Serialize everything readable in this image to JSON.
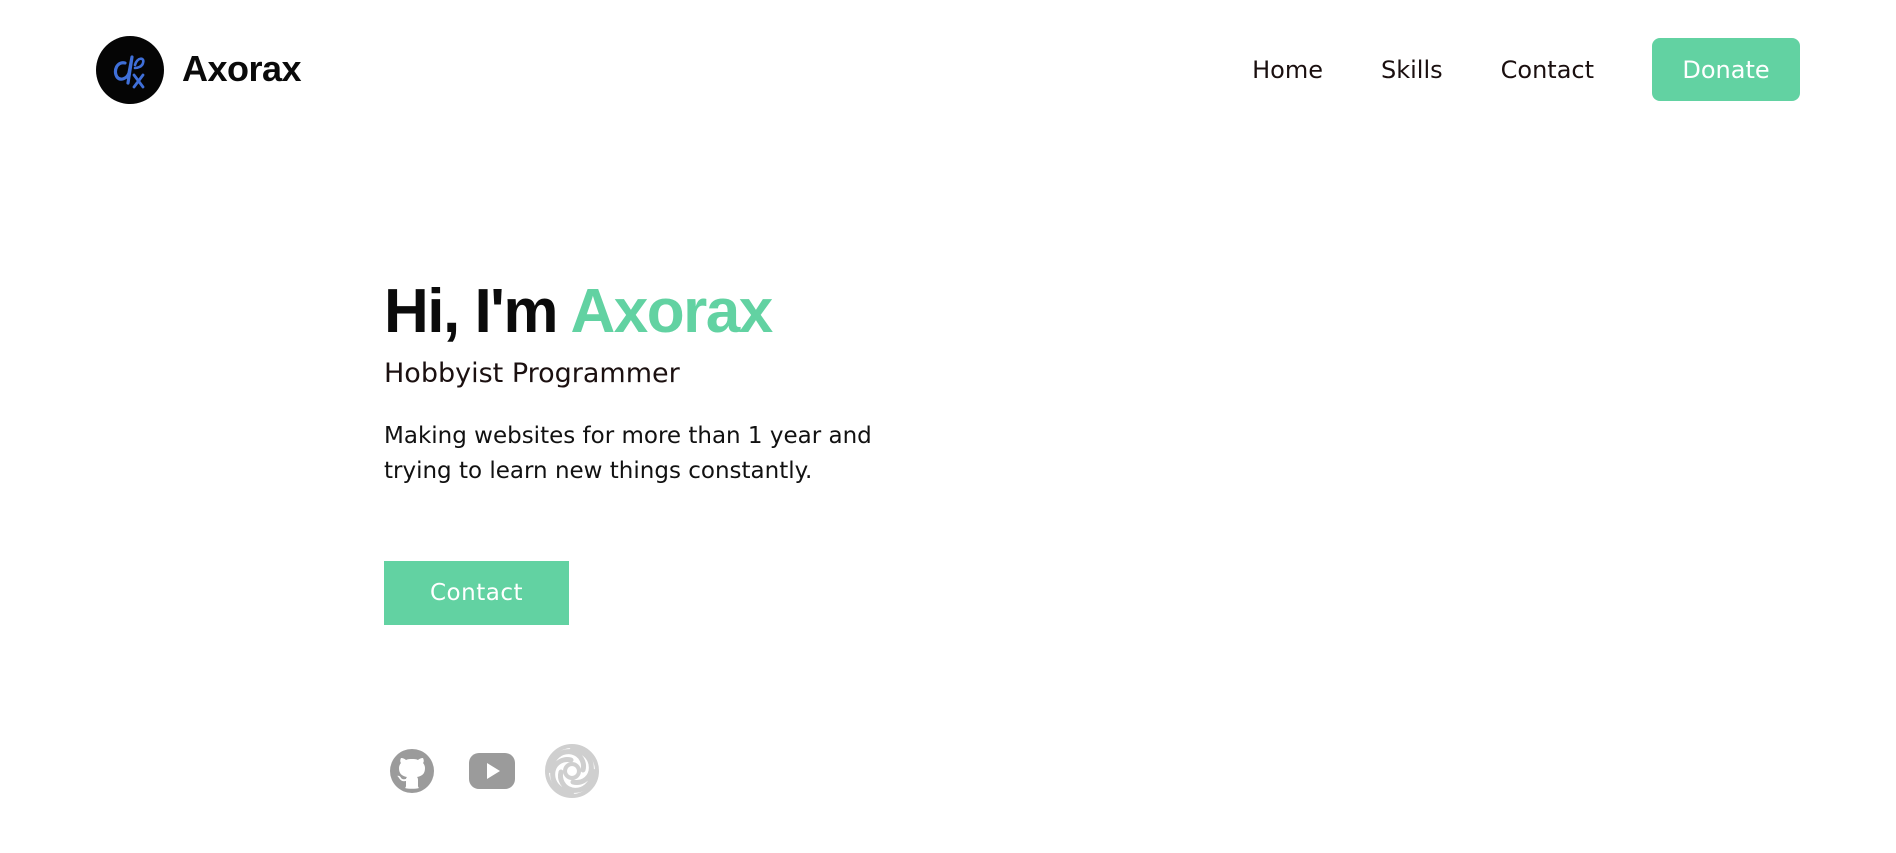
{
  "header": {
    "brand": "Axorax",
    "logo_icon": "axorax-logo-icon",
    "nav": [
      {
        "label": "Home"
      },
      {
        "label": "Skills"
      },
      {
        "label": "Contact"
      }
    ],
    "donate_label": "Donate"
  },
  "hero": {
    "greeting": "Hi, I'm",
    "name": "Axorax",
    "subtitle": "Hobbyist Programmer",
    "description": "Making websites for more than 1 year and trying to learn new things constantly.",
    "contact_label": "Contact"
  },
  "socials": [
    {
      "icon": "github-icon"
    },
    {
      "icon": "youtube-icon"
    },
    {
      "icon": "spiral-icon"
    }
  ],
  "colors": {
    "accent": "#62d2a2",
    "text": "#111111",
    "icon_gray": "#9b9b9b",
    "background": "#ffffff"
  }
}
